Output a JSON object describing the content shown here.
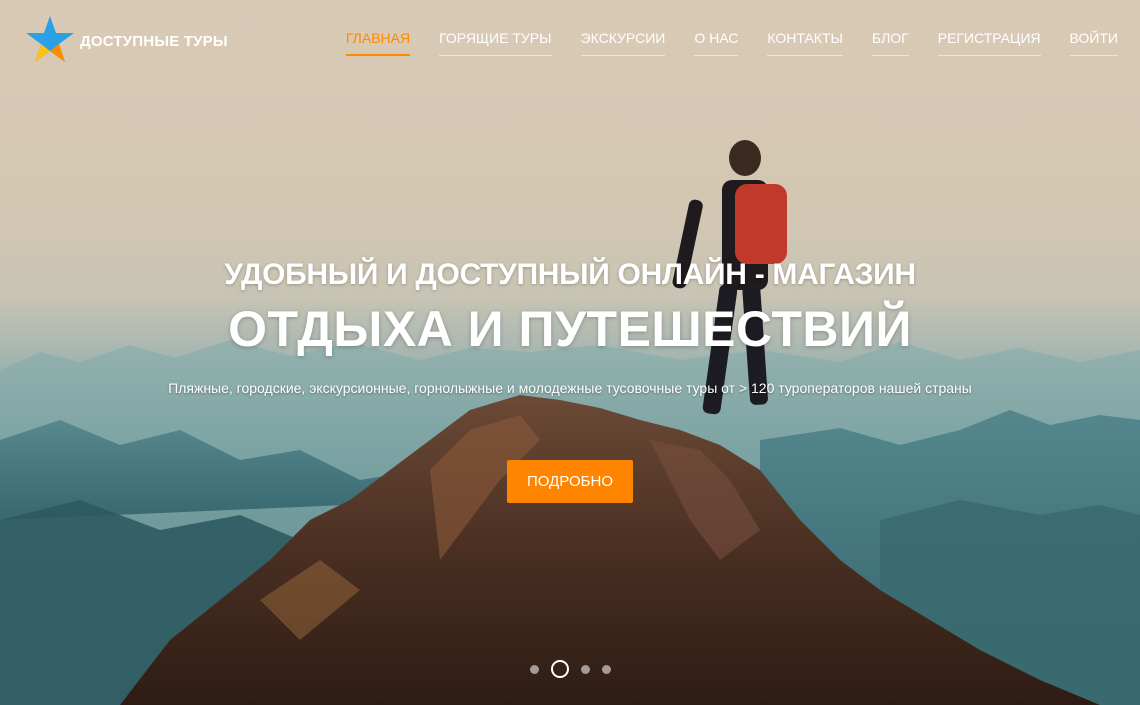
{
  "brand": {
    "name": "ДОСТУПНЫЕ ТУРЫ",
    "colors": {
      "star_blue": "#2aa0e6",
      "star_yellow": "#ffc20e",
      "star_orange": "#ff8a00"
    }
  },
  "nav": {
    "items": [
      {
        "label": "ГЛАВНАЯ",
        "active": true
      },
      {
        "label": "ГОРЯЩИЕ ТУРЫ",
        "active": false
      },
      {
        "label": "ЭКСКУРСИИ",
        "active": false
      },
      {
        "label": "О НАС",
        "active": false
      },
      {
        "label": "КОНТАКТЫ",
        "active": false
      },
      {
        "label": "БЛОГ",
        "active": false
      },
      {
        "label": "РЕГИСТРАЦИЯ",
        "active": false
      },
      {
        "label": "ВОЙТИ",
        "active": false
      }
    ],
    "active_color": "#ff8a00"
  },
  "hero": {
    "headline_line1": "УДОБНЫЙ И ДОСТУПНЫЙ ОНЛАЙН - МАГАЗИН",
    "headline_line2": "ОТДЫХА И ПУТЕШЕСТВИЙ",
    "subtitle": "Пляжные, городские, экскурсионные, горнолыжные и молодежные тусовочные туры от > 120 туроператоров нашей страны",
    "cta_label": "ПОДРОБНО",
    "cta_color": "#ff8500",
    "slider": {
      "slides": 4,
      "active_index": 1
    }
  }
}
